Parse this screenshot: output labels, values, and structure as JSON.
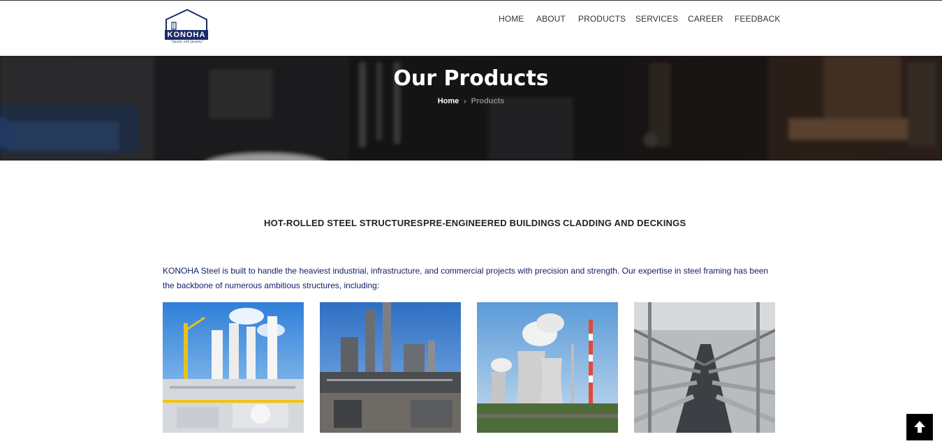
{
  "brand": {
    "name": "KONOHA",
    "tagline": "\"Quality with Quantity\""
  },
  "nav": {
    "items": [
      "HOME",
      "ABOUT",
      "PRODUCTS",
      "SERVICES",
      "CAREER",
      "FEEDBACK"
    ]
  },
  "hero": {
    "title": "Our Products",
    "breadcrumb": {
      "home": "Home",
      "separator": "›",
      "current": "Products"
    }
  },
  "tabs": [
    "HOT-ROLLED STEEL STRUCTURES",
    "PRE-ENGINEERED BUILDINGS",
    "CLADDING AND DECKINGS"
  ],
  "intro": {
    "text": "KONOHA Steel is built to handle the heaviest industrial, infrastructure, and commercial projects with precision and strength. Our expertise in steel framing has been the backbone of numerous ambitious structures, including:"
  },
  "gallery": [
    "refinery-photo",
    "industrial-plant-photo",
    "cooling-towers-photo",
    "steel-frame-interior-photo"
  ],
  "colors": {
    "brand_navy": "#1c2b6b",
    "intro_text": "#14206a",
    "scroll_button": "#000000"
  },
  "icons": {
    "scroll_top": "arrow-up-icon",
    "breadcrumb_separator": "chevron-right-icon"
  }
}
